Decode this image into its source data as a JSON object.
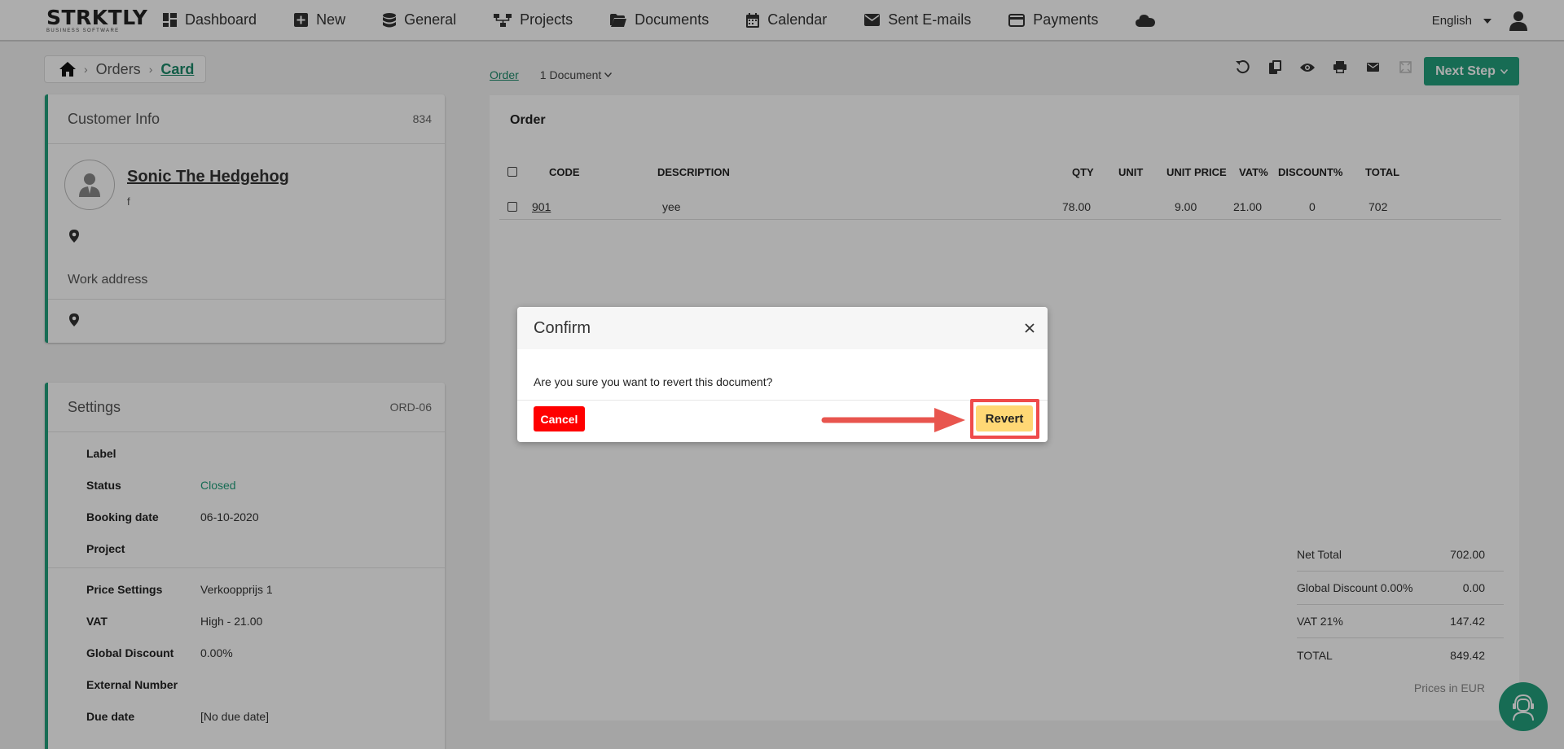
{
  "app": {
    "logo_text": "STRKTLY",
    "logo_sub": "BUSINESS SOFTWARE"
  },
  "nav": {
    "items": [
      {
        "label": "Dashboard",
        "icon": "dashboard-icon"
      },
      {
        "label": "New",
        "icon": "plus-square-icon"
      },
      {
        "label": "General",
        "icon": "database-icon"
      },
      {
        "label": "Projects",
        "icon": "sitemap-icon"
      },
      {
        "label": "Documents",
        "icon": "folder-icon"
      },
      {
        "label": "Calendar",
        "icon": "calendar-icon"
      },
      {
        "label": "Sent E-mails",
        "icon": "envelope-icon"
      },
      {
        "label": "Payments",
        "icon": "credit-card-icon"
      }
    ],
    "language": "English"
  },
  "breadcrumb": {
    "items": [
      "Orders",
      "Card"
    ]
  },
  "customer": {
    "panel_title": "Customer Info",
    "id": "834",
    "name": "Sonic The Hedgehog",
    "sub": "f",
    "work_address_label": "Work address"
  },
  "settings": {
    "panel_title": "Settings",
    "code": "ORD-06",
    "rows": [
      {
        "key": "Label",
        "value": ""
      },
      {
        "key": "Status",
        "value": "Closed"
      },
      {
        "key": "Booking date",
        "value": "06-10-2020"
      },
      {
        "key": "Project",
        "value": ""
      },
      {
        "key": "Price Settings",
        "value": "Verkoopprijs 1"
      },
      {
        "key": "VAT",
        "value": "High - 21.00"
      },
      {
        "key": "Global Discount",
        "value": "0.00%"
      },
      {
        "key": "External Number",
        "value": ""
      },
      {
        "key": "Due date",
        "value": "[No due date]"
      }
    ]
  },
  "order": {
    "tab_label": "Order",
    "doc_selector": "1 Document",
    "next_step": "Next Step",
    "title": "Order",
    "columns": [
      "CODE",
      "DESCRIPTION",
      "QTY",
      "UNIT",
      "UNIT PRICE",
      "VAT%",
      "DISCOUNT%",
      "TOTAL"
    ],
    "rows": [
      {
        "code": "901",
        "description": "yee",
        "qty": "78.00",
        "unit": "",
        "unit_price": "9.00",
        "vat": "21.00",
        "discount": "0",
        "total": "702"
      }
    ],
    "totals": [
      {
        "label": "Net Total",
        "value": "702.00"
      },
      {
        "label": "Global Discount 0.00%",
        "value": "0.00"
      },
      {
        "label": "VAT 21%",
        "value": "147.42"
      },
      {
        "label": "TOTAL",
        "value": "849.42"
      }
    ],
    "prices_note": "Prices in EUR"
  },
  "modal": {
    "title": "Confirm",
    "message": "Are you sure you want to revert this document?",
    "cancel_label": "Cancel",
    "revert_label": "Revert"
  },
  "colors": {
    "accent": "#22a07c",
    "cancel": "#ff0000",
    "revert": "#ffd875",
    "highlight": "#ef4b4b"
  }
}
